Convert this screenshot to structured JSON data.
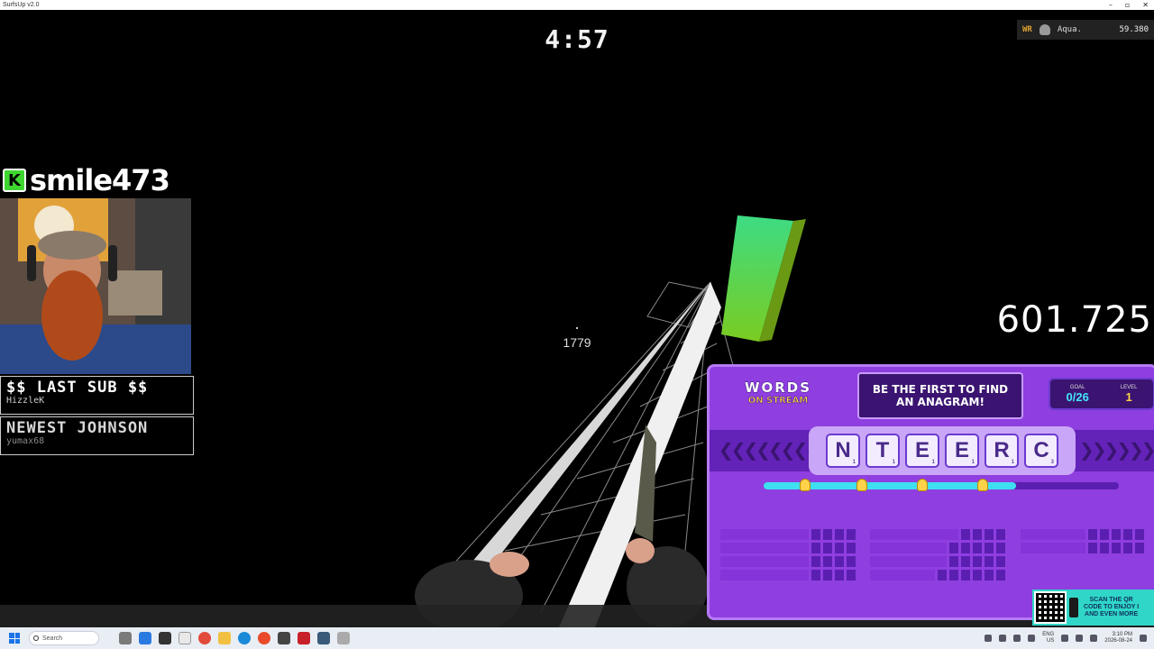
{
  "window": {
    "title": "SurfsUp v2.0",
    "controls": [
      "–",
      "▫",
      "✕"
    ]
  },
  "hud": {
    "timer": "4:57",
    "speed": "1779",
    "score": "601.725",
    "world_record": {
      "label": "WR",
      "player": "Aqua.",
      "time": "59.380"
    }
  },
  "stream": {
    "username": "smile473",
    "platform_icon": "kick-icon",
    "last_sub": {
      "label": "$$ LAST SUB $$",
      "value": "HizzleK"
    },
    "newest": {
      "label": "NEWEST JOHNSON",
      "value": "yumax68"
    }
  },
  "words_on_stream": {
    "logo_top": "WORDS",
    "logo_bottom": "ON STREAM",
    "banner": "BE THE FIRST TO FIND AN ANAGRAM!",
    "goal_label": "GOAL",
    "goal_value": "0/26",
    "level_label": "LEVEL",
    "level_value": "1",
    "letters": [
      {
        "char": "N",
        "score": "1"
      },
      {
        "char": "T",
        "score": "1"
      },
      {
        "char": "E",
        "score": "1"
      },
      {
        "char": "E",
        "score": "1"
      },
      {
        "char": "R",
        "score": "1"
      },
      {
        "char": "C",
        "score": "3"
      }
    ],
    "progress": 0.71,
    "qr_text": [
      "SCAN THE QR",
      "CODE TO ENJOY I",
      "AND EVEN MORE"
    ]
  },
  "taskbar": {
    "search_placeholder": "Search",
    "lang": "ENG",
    "lang_sub": "US",
    "time": "3:10 PM",
    "date": "2026-08-24"
  },
  "colors": {
    "panel": "#8f3ee0",
    "accent_cyan": "#3de0f0",
    "accent_yellow": "#ffd24a",
    "kick_green": "#3fd631"
  }
}
